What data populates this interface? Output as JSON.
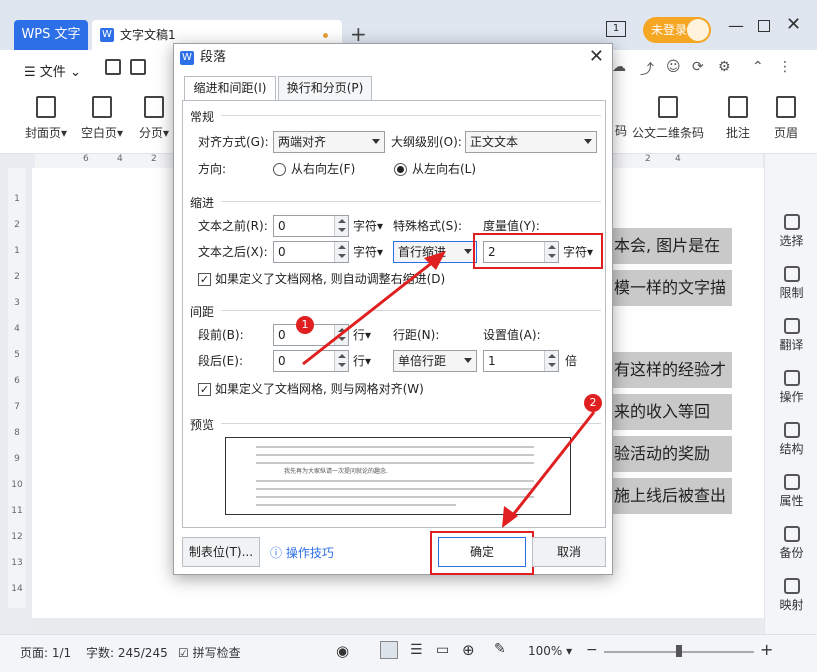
{
  "titlebar": {
    "app_tab": "WPS 文字",
    "doc_tab": "文字文稿1",
    "login": "未登录",
    "page_count_icon": "1"
  },
  "menu": {
    "file": "文件"
  },
  "ribbon": {
    "items": [
      "封面页",
      "空白页",
      "分页"
    ],
    "right_items": [
      "码",
      "公文二维条码",
      "批注",
      "页眉"
    ]
  },
  "ruler": {
    "ticks": [
      "6",
      "4",
      "2",
      "2",
      "4"
    ]
  },
  "vruler": {
    "ticks": [
      "1",
      "2",
      "1",
      "2",
      "3",
      "4",
      "5",
      "6",
      "7",
      "8",
      "9",
      "10",
      "11",
      "12",
      "13",
      "14"
    ]
  },
  "document": {
    "lines": [
      "本会, 图片是在实",
      "模一样的文字描",
      "有这样的经验才",
      "来的收入等回报。",
      "验活动的奖励 (有",
      "施上线后被查出"
    ]
  },
  "sidebar": {
    "items": [
      "选择",
      "限制",
      "翻译",
      "操作",
      "结构",
      "属性",
      "备份",
      "映射"
    ]
  },
  "statusbar": {
    "page": "页面: 1/1",
    "words": "字数: 245/245",
    "spell": "拼写检查",
    "zoom": "100%"
  },
  "dialog": {
    "title": "段落",
    "tabs": [
      "缩进和间距(I)",
      "换行和分页(P)"
    ],
    "general": {
      "header": "常规",
      "align_label": "对齐方式(G):",
      "align_value": "两端对齐",
      "outline_label": "大纲级别(O):",
      "outline_value": "正文文本",
      "direction_label": "方向:",
      "rtl": "从右向左(F)",
      "ltr": "从左向右(L)"
    },
    "indent": {
      "header": "缩进",
      "before_label": "文本之前(R):",
      "before_value": "0",
      "before_unit": "字符",
      "after_label": "文本之后(X):",
      "after_value": "0",
      "after_unit": "字符",
      "special_label": "特殊格式(S):",
      "special_value": "首行缩进",
      "measure_label": "度量值(Y):",
      "measure_value": "2",
      "measure_unit": "字符",
      "grid_check": "如果定义了文档网格, 则自动调整右缩进(D)"
    },
    "spacing": {
      "header": "间距",
      "before_label": "段前(B):",
      "before_value": "0",
      "before_unit": "行",
      "after_label": "段后(E):",
      "after_value": "0",
      "after_unit": "行",
      "line_label": "行距(N):",
      "line_value": "单倍行距",
      "set_label": "设置值(A):",
      "set_value": "1",
      "set_unit": "倍",
      "grid_check": "如果定义了文档网格, 则与网格对齐(W)"
    },
    "preview": {
      "header": "预览",
      "sample": "我先再为大家纵请一次提问就论的趣念."
    },
    "buttons": {
      "tabs": "制表位(T)...",
      "tips": "操作技巧",
      "ok": "确定",
      "cancel": "取消"
    }
  },
  "annotations": {
    "badge1": "1",
    "badge2": "2"
  },
  "colors": {
    "accent": "#2c6fe6",
    "annotation": "#e02020",
    "login": "#f5a623"
  }
}
